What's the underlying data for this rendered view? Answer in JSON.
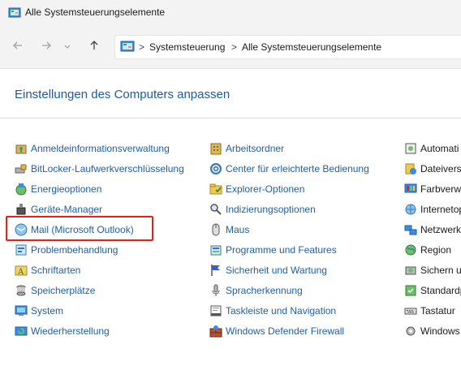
{
  "window": {
    "title": "Alle Systemsteuerungselemente"
  },
  "nav": {
    "back_icon": "arrow-left-icon",
    "forward_icon": "arrow-right-icon",
    "recent_icon": "chevron-down-icon",
    "up_icon": "arrow-up-icon"
  },
  "address": {
    "breadcrumbs": [
      "Systemsteuerung",
      "Alle Systemsteuerungselemente"
    ],
    "separator": ">"
  },
  "main": {
    "title": "Einstellungen des Computers anpassen"
  },
  "columns": [
    {
      "items": [
        {
          "label": "Anmeldeinformationsverwaltung",
          "icon": "credential-manager-icon"
        },
        {
          "label": "BitLocker-Laufwerkverschlüsselung",
          "icon": "bitlocker-icon"
        },
        {
          "label": "Energieoptionen",
          "icon": "power-options-icon"
        },
        {
          "label": "Geräte-Manager",
          "icon": "device-manager-icon"
        },
        {
          "label": "Mail (Microsoft Outlook)",
          "icon": "mail-icon"
        },
        {
          "label": "Problembehandlung",
          "icon": "troubleshooting-icon"
        },
        {
          "label": "Schriftarten",
          "icon": "fonts-icon"
        },
        {
          "label": "Speicherplätze",
          "icon": "storage-spaces-icon"
        },
        {
          "label": "System",
          "icon": "system-icon"
        },
        {
          "label": "Wiederherstellung",
          "icon": "recovery-icon"
        }
      ]
    },
    {
      "items": [
        {
          "label": "Arbeitsordner",
          "icon": "work-folders-icon"
        },
        {
          "label": "Center für erleichterte Bedienung",
          "icon": "ease-of-access-icon"
        },
        {
          "label": "Explorer-Optionen",
          "icon": "explorer-options-icon"
        },
        {
          "label": "Indizierungsoptionen",
          "icon": "indexing-options-icon"
        },
        {
          "label": "Maus",
          "icon": "mouse-icon"
        },
        {
          "label": "Programme und Features",
          "icon": "programs-features-icon"
        },
        {
          "label": "Sicherheit und Wartung",
          "icon": "security-maintenance-icon"
        },
        {
          "label": "Spracherkennung",
          "icon": "speech-recognition-icon"
        },
        {
          "label": "Taskleiste und Navigation",
          "icon": "taskbar-icon"
        },
        {
          "label": "Windows Defender Firewall",
          "icon": "firewall-icon"
        }
      ]
    },
    {
      "items": [
        {
          "label": "Automati",
          "icon": "autoplay-icon"
        },
        {
          "label": "Dateiversi",
          "icon": "file-history-icon"
        },
        {
          "label": "Farbverwa",
          "icon": "color-management-icon"
        },
        {
          "label": "Internetop",
          "icon": "internet-options-icon"
        },
        {
          "label": "Netzwerk",
          "icon": "network-icon"
        },
        {
          "label": "Region",
          "icon": "region-icon"
        },
        {
          "label": "Sichern un",
          "icon": "backup-restore-icon"
        },
        {
          "label": "Standardp",
          "icon": "default-programs-icon"
        },
        {
          "label": "Tastatur",
          "icon": "keyboard-icon"
        },
        {
          "label": "Windows",
          "icon": "windows-tools-icon"
        }
      ]
    }
  ],
  "colors": {
    "accent": "#1e5aa0",
    "link": "#1f5fa6",
    "highlight": "#e2231a"
  }
}
